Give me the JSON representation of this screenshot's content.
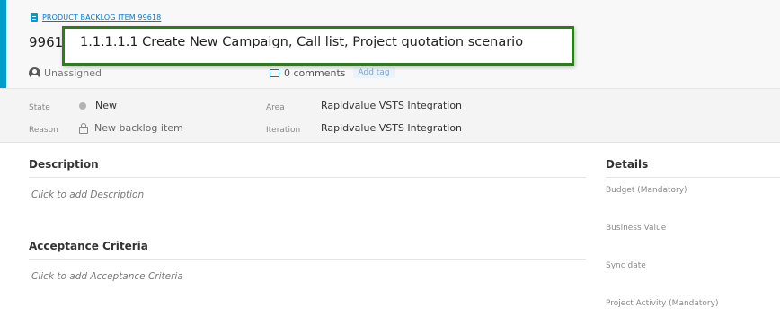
{
  "header": {
    "type_label": "PRODUCT BACKLOG ITEM 99618",
    "id": "99618",
    "title": "1.1.1.1.1 Create New Campaign, Call list, Project quotation scenario",
    "assignee": "Unassigned",
    "comments": "0 comments",
    "add_tag": "Add tag"
  },
  "fields": {
    "state_label": "State",
    "state_value": "New",
    "reason_label": "Reason",
    "reason_value": "New backlog item",
    "area_label": "Area",
    "area_value": "Rapidvalue VSTS Integration",
    "iteration_label": "Iteration",
    "iteration_value": "Rapidvalue VSTS Integration"
  },
  "description": {
    "heading": "Description",
    "placeholder": "Click to add Description"
  },
  "acceptance": {
    "heading": "Acceptance Criteria",
    "placeholder": "Click to add Acceptance Criteria"
  },
  "details": {
    "heading": "Details",
    "fields": [
      "Budget (Mandatory)",
      "Business Value",
      "Sync date",
      "Project Activity (Mandatory)"
    ]
  },
  "colors": {
    "accent": "#009ccc",
    "highlight": "#2e7d1c",
    "link": "#0078d4"
  }
}
